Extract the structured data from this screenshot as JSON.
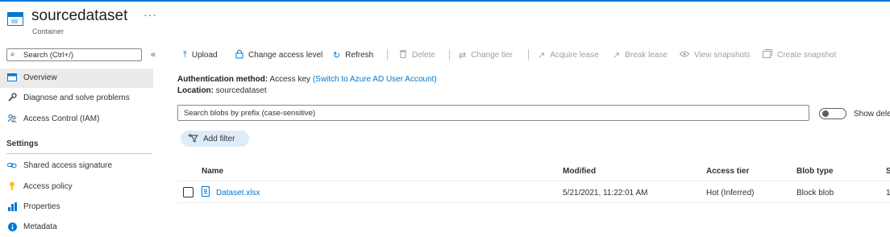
{
  "header": {
    "title": "sourcedataset",
    "subtitle": "Container",
    "more": "···",
    "top_strip_color": "#0078d4"
  },
  "sidebar": {
    "search_placeholder": "Search (Ctrl+/)",
    "collapse_glyph": "«",
    "items": [
      {
        "label": "Overview",
        "icon": "overview-icon",
        "active": true
      },
      {
        "label": "Diagnose and solve problems",
        "icon": "wrench-icon"
      },
      {
        "label": "Access Control (IAM)",
        "icon": "people-icon"
      }
    ],
    "settings_heading": "Settings",
    "settings_items": [
      {
        "label": "Shared access signature",
        "icon": "link-icon"
      },
      {
        "label": "Access policy",
        "icon": "key-icon"
      },
      {
        "label": "Properties",
        "icon": "bars-icon"
      },
      {
        "label": "Metadata",
        "icon": "info-icon"
      }
    ]
  },
  "toolbar": {
    "upload": "Upload",
    "change_access_level": "Change access level",
    "refresh": "Refresh",
    "delete": "Delete",
    "change_tier": "Change tier",
    "acquire_lease": "Acquire lease",
    "break_lease": "Break lease",
    "view_snapshots": "View snapshots",
    "create_snapshot": "Create snapshot"
  },
  "info": {
    "auth_label": "Authentication method:",
    "auth_value": "Access key",
    "auth_link": "(Switch to Azure AD User Account)",
    "location_label": "Location:",
    "location_value": "sourcedataset"
  },
  "blob_search": {
    "placeholder": "Search blobs by prefix (case-sensitive)",
    "toggle_label": "Show dele",
    "toggle_on": false
  },
  "add_filter": "Add filter",
  "table": {
    "columns": [
      "Name",
      "Modified",
      "Access tier",
      "Blob type",
      "S"
    ],
    "rows": [
      {
        "name": "Dataset.xlsx",
        "modified": "5/21/2021, 11:22:01 AM",
        "access_tier": "Hot (Inferred)",
        "blob_type": "Block blob",
        "size": "1"
      }
    ]
  },
  "colors": {
    "accent": "#0078d4",
    "active_nav": "#edebe9",
    "filter_pill": "#deecf9"
  }
}
